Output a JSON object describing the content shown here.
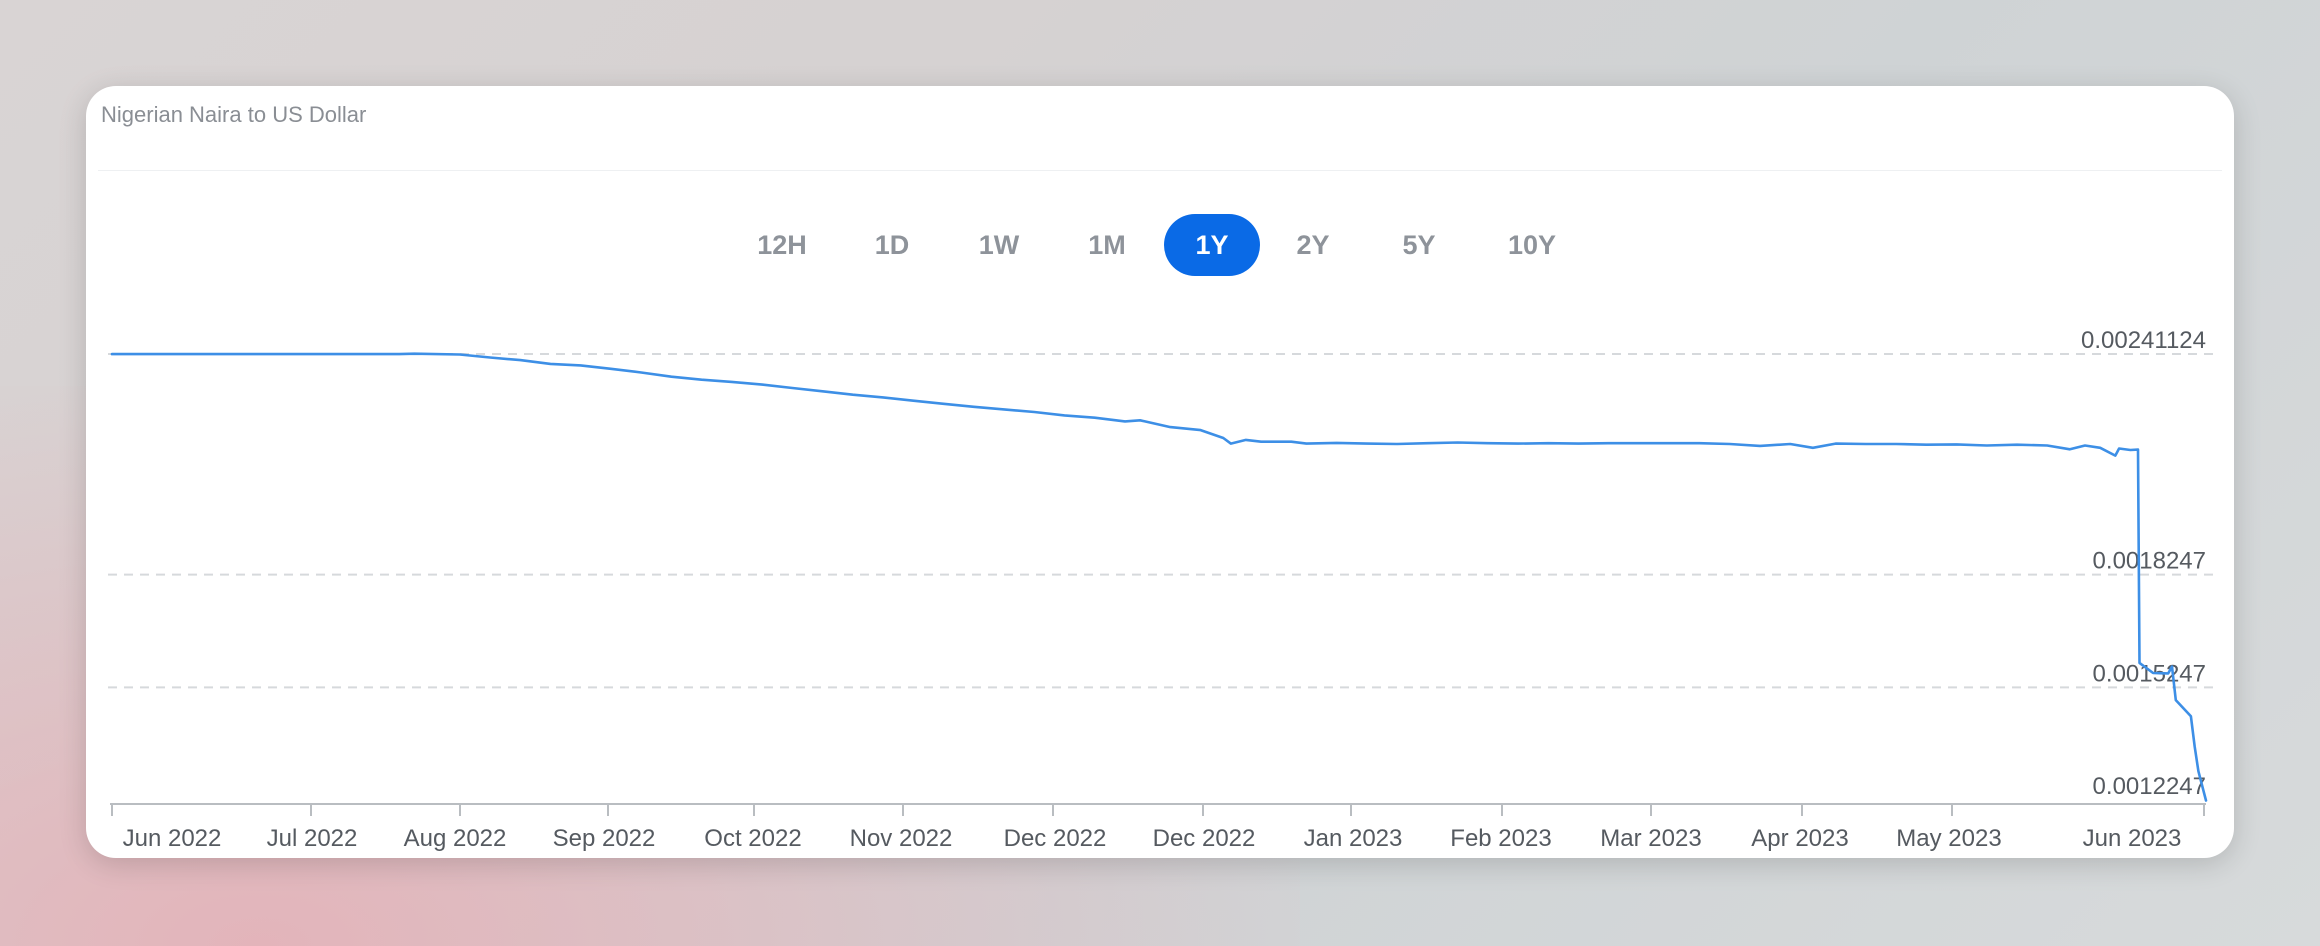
{
  "card": {
    "title": "Nigerian Naira to US Dollar"
  },
  "range_tabs": [
    {
      "label": "12H",
      "active": false
    },
    {
      "label": "1D",
      "active": false
    },
    {
      "label": "1W",
      "active": false
    },
    {
      "label": "1M",
      "active": false
    },
    {
      "label": "1Y",
      "active": true
    },
    {
      "label": "2Y",
      "active": false
    },
    {
      "label": "5Y",
      "active": false
    },
    {
      "label": "10Y",
      "active": false
    }
  ],
  "colors": {
    "accent": "#0a6ae6",
    "line": "#3d8fe6",
    "grid": "#d6d9dc"
  },
  "chart_data": {
    "type": "line",
    "title": "Nigerian Naira to US Dollar",
    "xlabel": "",
    "ylabel": "",
    "grid": true,
    "ylim": [
      0.00122,
      0.0024113
    ],
    "y_ticks": [
      {
        "value": 0.00241124,
        "label": "0.00241124"
      },
      {
        "value": 0.0018247,
        "label": "0.0018247"
      },
      {
        "value": 0.0015247,
        "label": "0.0015247"
      },
      {
        "value": 0.0012247,
        "label": "0.0012247"
      }
    ],
    "x_ticks": [
      "Jun 2022",
      "Jul 2022",
      "Aug 2022",
      "Sep 2022",
      "Oct 2022",
      "Nov 2022",
      "Dec 2022",
      "Dec 2022",
      "Jan 2023",
      "Feb 2023",
      "Mar 2023",
      "Apr 2023",
      "May 2023",
      "Jun 2023"
    ],
    "series": [
      {
        "points": [
          [
            0.0,
            0.002411
          ],
          [
            2.0,
            0.002411
          ],
          [
            3.8,
            0.002411
          ],
          [
            4.0,
            0.002412
          ],
          [
            4.6,
            0.00241
          ],
          [
            5.0,
            0.002402
          ],
          [
            5.4,
            0.002395
          ],
          [
            5.8,
            0.002385
          ],
          [
            6.2,
            0.002381
          ],
          [
            6.6,
            0.002372
          ],
          [
            7.0,
            0.002362
          ],
          [
            7.4,
            0.002351
          ],
          [
            7.8,
            0.002343
          ],
          [
            8.2,
            0.002337
          ],
          [
            8.6,
            0.00233
          ],
          [
            9.0,
            0.002321
          ],
          [
            9.4,
            0.002312
          ],
          [
            9.8,
            0.002303
          ],
          [
            10.2,
            0.002296
          ],
          [
            10.6,
            0.002287
          ],
          [
            11.0,
            0.002279
          ],
          [
            11.4,
            0.002271
          ],
          [
            11.8,
            0.002264
          ],
          [
            12.2,
            0.002257
          ],
          [
            12.6,
            0.002248
          ],
          [
            13.0,
            0.002242
          ],
          [
            13.4,
            0.002232
          ],
          [
            13.6,
            0.002235
          ],
          [
            14.0,
            0.002217
          ],
          [
            14.4,
            0.002209
          ],
          [
            14.7,
            0.002188
          ],
          [
            14.8,
            0.002173
          ],
          [
            15.0,
            0.002183
          ],
          [
            15.2,
            0.002178
          ],
          [
            15.6,
            0.002178
          ],
          [
            15.8,
            0.002173
          ],
          [
            16.2,
            0.002175
          ],
          [
            16.6,
            0.002173
          ],
          [
            17.0,
            0.002172
          ],
          [
            17.4,
            0.002174
          ],
          [
            17.8,
            0.002176
          ],
          [
            18.2,
            0.002174
          ],
          [
            18.6,
            0.002173
          ],
          [
            19.0,
            0.002174
          ],
          [
            19.4,
            0.002173
          ],
          [
            19.8,
            0.002174
          ],
          [
            20.2,
            0.002174
          ],
          [
            20.6,
            0.002174
          ],
          [
            21.0,
            0.002174
          ],
          [
            21.4,
            0.002172
          ],
          [
            21.8,
            0.002167
          ],
          [
            22.2,
            0.002172
          ],
          [
            22.5,
            0.002162
          ],
          [
            22.8,
            0.002173
          ],
          [
            23.2,
            0.002172
          ],
          [
            23.6,
            0.002172
          ],
          [
            24.0,
            0.00217
          ],
          [
            24.4,
            0.002171
          ],
          [
            24.8,
            0.002168
          ],
          [
            25.2,
            0.00217
          ],
          [
            25.6,
            0.002168
          ],
          [
            25.9,
            0.002158
          ],
          [
            26.1,
            0.002168
          ],
          [
            26.3,
            0.002162
          ],
          [
            26.5,
            0.002141
          ],
          [
            26.55,
            0.00216
          ],
          [
            26.7,
            0.002156
          ],
          [
            26.8,
            0.002157
          ],
          [
            26.82,
            0.00159
          ],
          [
            27.0,
            0.001563
          ],
          [
            27.2,
            0.001562
          ],
          [
            27.25,
            0.00158
          ],
          [
            27.3,
            0.001491
          ],
          [
            27.5,
            0.001448
          ],
          [
            27.55,
            0.001367
          ],
          [
            27.6,
            0.001302
          ],
          [
            27.7,
            0.001224
          ]
        ]
      }
    ]
  }
}
